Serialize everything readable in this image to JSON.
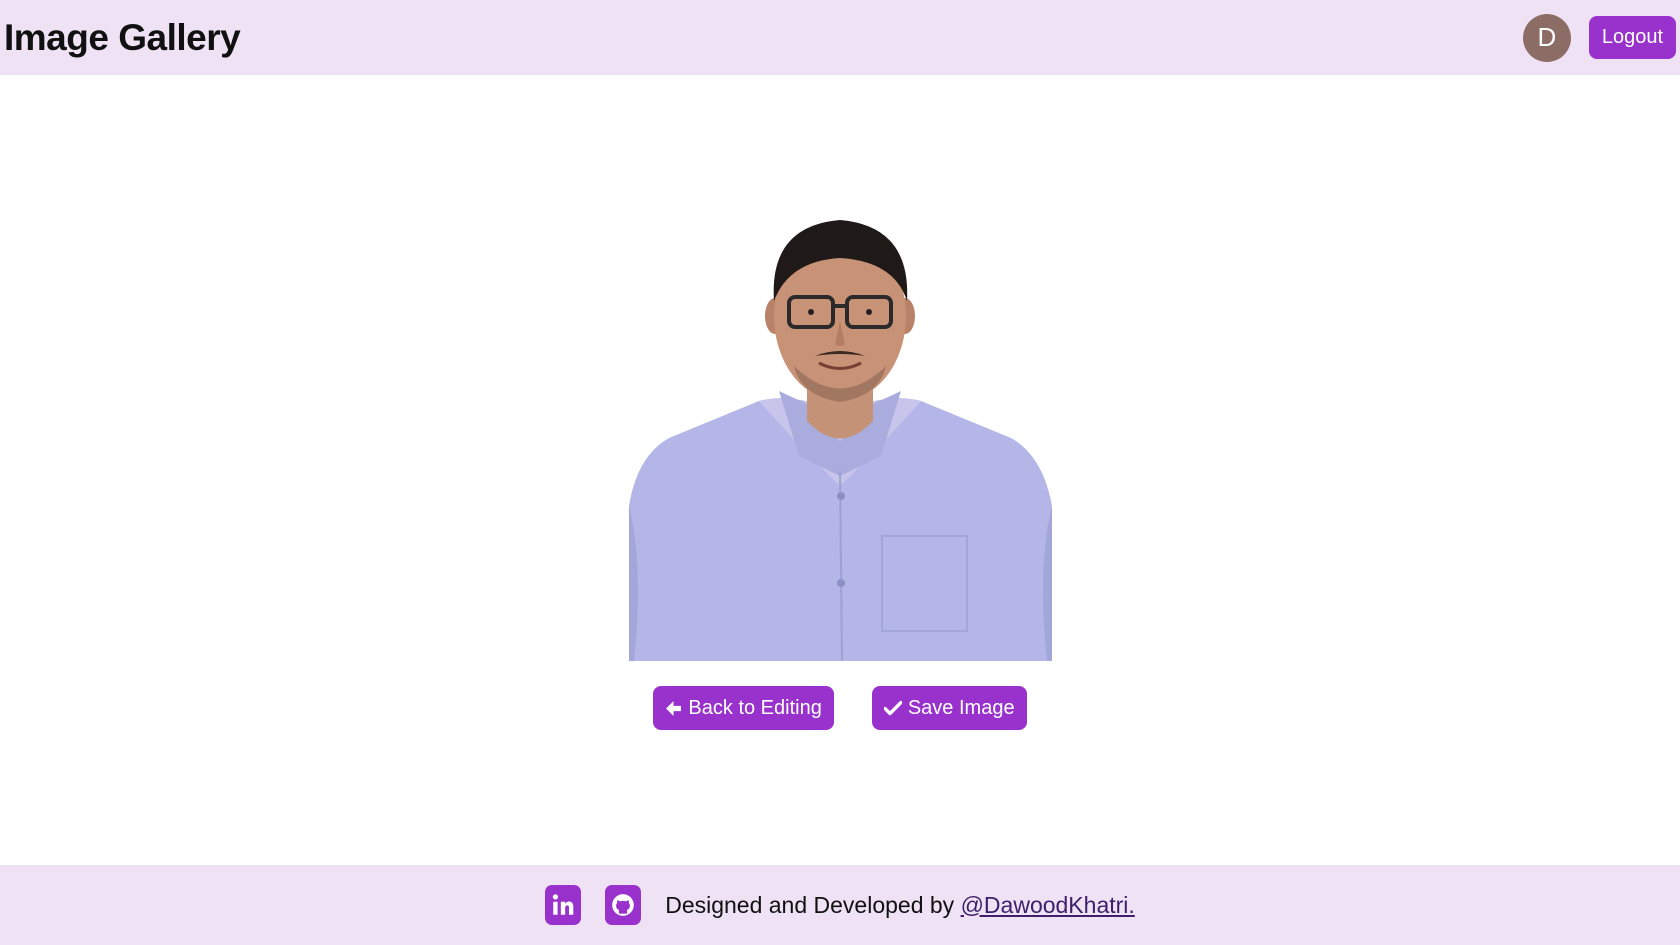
{
  "header": {
    "title": "Image Gallery",
    "avatar_initial": "D",
    "logout_label": "Logout"
  },
  "main": {
    "back_label": "Back to Editing",
    "save_label": "Save Image",
    "back_icon": "arrow-left-icon",
    "save_icon": "check-icon"
  },
  "footer": {
    "credit_text": "Designed and Developed by ",
    "credit_link": "@DawoodKhatri.",
    "social_icons": [
      "linkedin-icon",
      "github-icon"
    ]
  },
  "colors": {
    "accent": "#9932cc",
    "header_bg": "#efe2f5",
    "avatar_bg": "#8c6d66"
  }
}
